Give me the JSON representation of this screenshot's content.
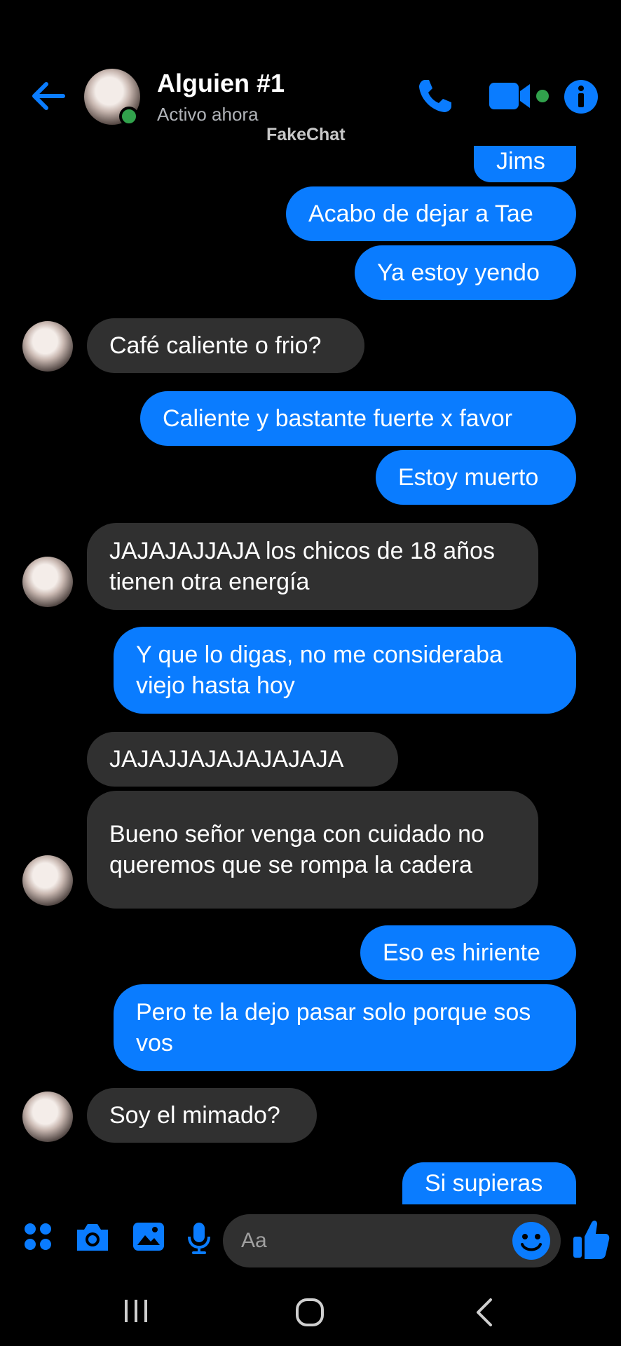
{
  "header": {
    "contact_name": "Alguien #1",
    "status": "Activo ahora",
    "watermark": "FakeChat",
    "accent_color": "#0a7cff",
    "online_color": "#31a24c",
    "icons": [
      "back-arrow-icon",
      "phone-icon",
      "video-camera-icon",
      "info-icon"
    ]
  },
  "messages": [
    {
      "from": "me",
      "text": "Jims"
    },
    {
      "from": "me",
      "text": "Acabo de dejar a Tae"
    },
    {
      "from": "me",
      "text": "Ya estoy yendo"
    },
    {
      "from": "them",
      "text": "Café caliente o frio?"
    },
    {
      "from": "me",
      "text": "Caliente y bastante fuerte x favor"
    },
    {
      "from": "me",
      "text": "Estoy muerto"
    },
    {
      "from": "them",
      "text": "JAJAJAJJAJA los chicos de 18 años tienen otra energía"
    },
    {
      "from": "me",
      "text": "Y que lo digas, no me consideraba viejo hasta hoy"
    },
    {
      "from": "them",
      "text": "JAJAJJAJAJAJAJAJA"
    },
    {
      "from": "them",
      "text": "Bueno señor venga con cuidado no queremos que se rompa la cadera"
    },
    {
      "from": "me",
      "text": "Eso es hiriente"
    },
    {
      "from": "me",
      "text": "Pero te la dejo pasar solo porque sos vos"
    },
    {
      "from": "them",
      "text": "Soy el mimado?"
    },
    {
      "from": "me",
      "text": "Si supieras"
    }
  ],
  "composer": {
    "placeholder": "Aa",
    "icons": [
      "apps-icon",
      "camera-icon",
      "gallery-icon",
      "microphone-icon",
      "emoji-icon",
      "thumbs-up-icon"
    ]
  },
  "system_nav": {
    "icons": [
      "recent-apps-icon",
      "home-icon",
      "back-icon"
    ]
  }
}
